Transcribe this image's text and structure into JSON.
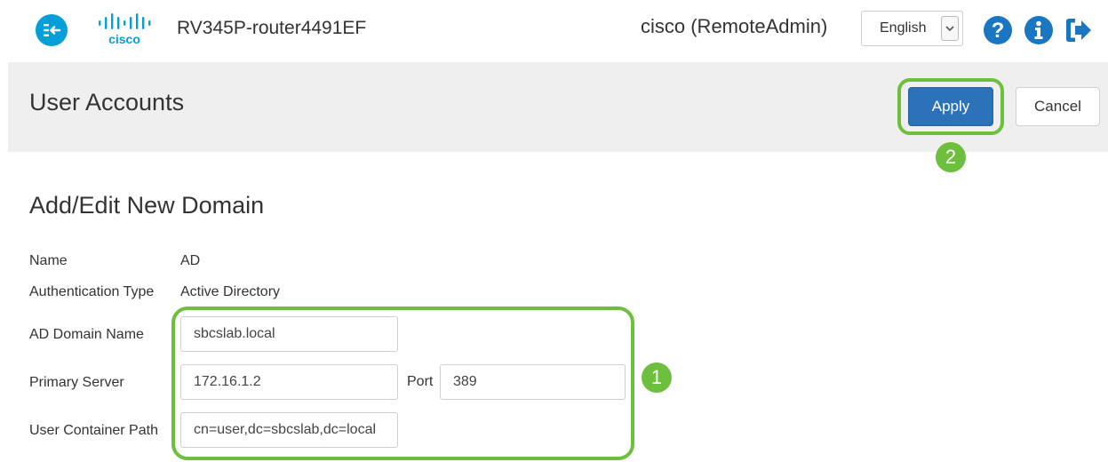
{
  "header": {
    "device_name": "RV345P-router4491EF",
    "user": "cisco (RemoteAdmin)",
    "language": {
      "selected": "English"
    },
    "icons": {
      "menu": "menu-toggle-icon",
      "logo": "cisco-logo",
      "help": "help-icon",
      "info": "info-icon",
      "logout": "logout-icon"
    }
  },
  "page": {
    "title": "User Accounts",
    "apply_label": "Apply",
    "cancel_label": "Cancel"
  },
  "annotations": {
    "step_1": "1",
    "step_2": "2"
  },
  "form": {
    "section_title": "Add/Edit New Domain",
    "name": {
      "label": "Name",
      "value": "AD"
    },
    "auth_type": {
      "label": "Authentication Type",
      "value": "Active Directory"
    },
    "ad_domain_name": {
      "label": "AD Domain Name",
      "value": "sbcslab.local"
    },
    "primary_server": {
      "label": "Primary Server",
      "value": "172.16.1.2"
    },
    "port": {
      "label": "Port",
      "value": "389"
    },
    "user_container_path": {
      "label": "User Container Path",
      "value": "cn=user,dc=sbcslab,dc=local"
    }
  },
  "colors": {
    "accent_blue": "#2c72b8",
    "menu_blue": "#049fd9",
    "highlight_green": "#6dbf3e",
    "icon_blue": "#1b76c2"
  }
}
